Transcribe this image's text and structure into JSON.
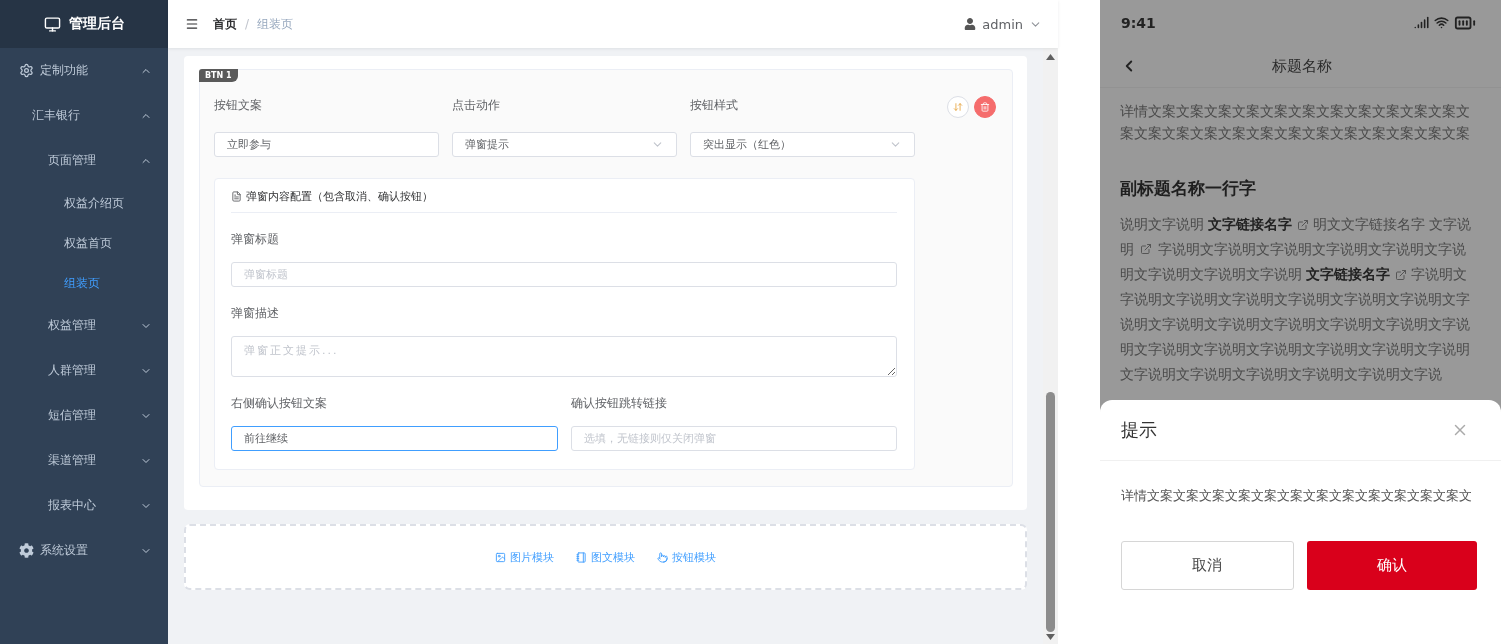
{
  "sidebar": {
    "logo": "管理后台",
    "menu": [
      {
        "label": "定制功能",
        "kind": "outline-gear",
        "expanded": true,
        "children": [
          {
            "label": "汇丰银行",
            "expanded": true,
            "children": [
              {
                "label": "页面管理",
                "expanded": true,
                "children": [
                  {
                    "label": "权益介绍页",
                    "selected": false
                  },
                  {
                    "label": "权益首页",
                    "selected": false
                  },
                  {
                    "label": "组装页",
                    "selected": true
                  }
                ]
              },
              {
                "label": "权益管理",
                "expanded": false
              },
              {
                "label": "人群管理",
                "expanded": false
              },
              {
                "label": "短信管理",
                "expanded": false
              },
              {
                "label": "渠道管理",
                "expanded": false
              },
              {
                "label": "报表中心",
                "expanded": false
              }
            ]
          }
        ]
      },
      {
        "label": "系统设置",
        "kind": "solid-gear",
        "expanded": false
      }
    ]
  },
  "header": {
    "breadcrumb": [
      "首页",
      "组装页"
    ],
    "separator": "/",
    "user": "admin"
  },
  "editor": {
    "tag": "BTN 1",
    "fields": [
      {
        "label": "按钮文案",
        "kind": "input",
        "value": "立即参与"
      },
      {
        "label": "点击动作",
        "kind": "select",
        "value": "弹窗提示"
      },
      {
        "label": "按钮样式",
        "kind": "select",
        "value": "突出显示（红色）"
      }
    ],
    "popup_config": {
      "title": "弹窗内容配置（包含取消、确认按钮）",
      "rows": [
        [
          {
            "label": "弹窗标题",
            "kind": "input",
            "placeholder": "弹窗标题",
            "focused": false
          }
        ],
        [
          {
            "label": "弹窗描述",
            "kind": "textarea",
            "placeholder": "弹窗正文提示...",
            "focused": false
          }
        ],
        [
          {
            "label": "右侧确认按钮文案",
            "kind": "input",
            "value": "前往继续",
            "focused": true
          },
          {
            "label": "确认按钮跳转链接",
            "kind": "input",
            "placeholder": "选填，无链接则仅关闭弹窗",
            "focused": false
          }
        ]
      ]
    }
  },
  "add_block": [
    {
      "label": "图片模块",
      "kind": "image"
    },
    {
      "label": "图文模块",
      "kind": "article"
    },
    {
      "label": "按钮模块",
      "kind": "button"
    }
  ],
  "phone": {
    "status_bar": {
      "time": "9:41"
    },
    "nav": {
      "title": "标题名称"
    },
    "intro": "详情文案文案文案文案文案文案文案文案文案文案文案文案文案文案文案文案文案文案文案文案文案文案文案文案",
    "subtitle": "副标题名称一行字",
    "paragraph": [
      {
        "kind": "text",
        "text": "说明文字说明"
      },
      {
        "kind": "link",
        "text": "文字链接名字"
      },
      {
        "kind": "text",
        "text": "明文文字链接名字 文字说明"
      },
      {
        "kind": "icon"
      },
      {
        "kind": "text",
        "text": "字说明文字说明文字说明文字说明文字说明文字说明文字说明文字说明文字说明"
      },
      {
        "kind": "link",
        "text": "文字链接名字"
      },
      {
        "kind": "text",
        "text": "字说明文字说明文字说明文字说明文字说明文字说明文字说明文字说明文字说明文字说明文字说明文字说明文字说明文字说明文字说明文字说明文字说明文字说明文字说明文字说明文字说明文字说明文字说明文字说明文字说明文字说"
      }
    ],
    "dialog": {
      "title": "提示",
      "message": "详情文案文案文案文案文案文案文案文案文案文案文案文案文",
      "buttons": [
        {
          "label": "取消",
          "kind": "secondary"
        },
        {
          "label": "确认",
          "kind": "primary"
        }
      ]
    }
  }
}
